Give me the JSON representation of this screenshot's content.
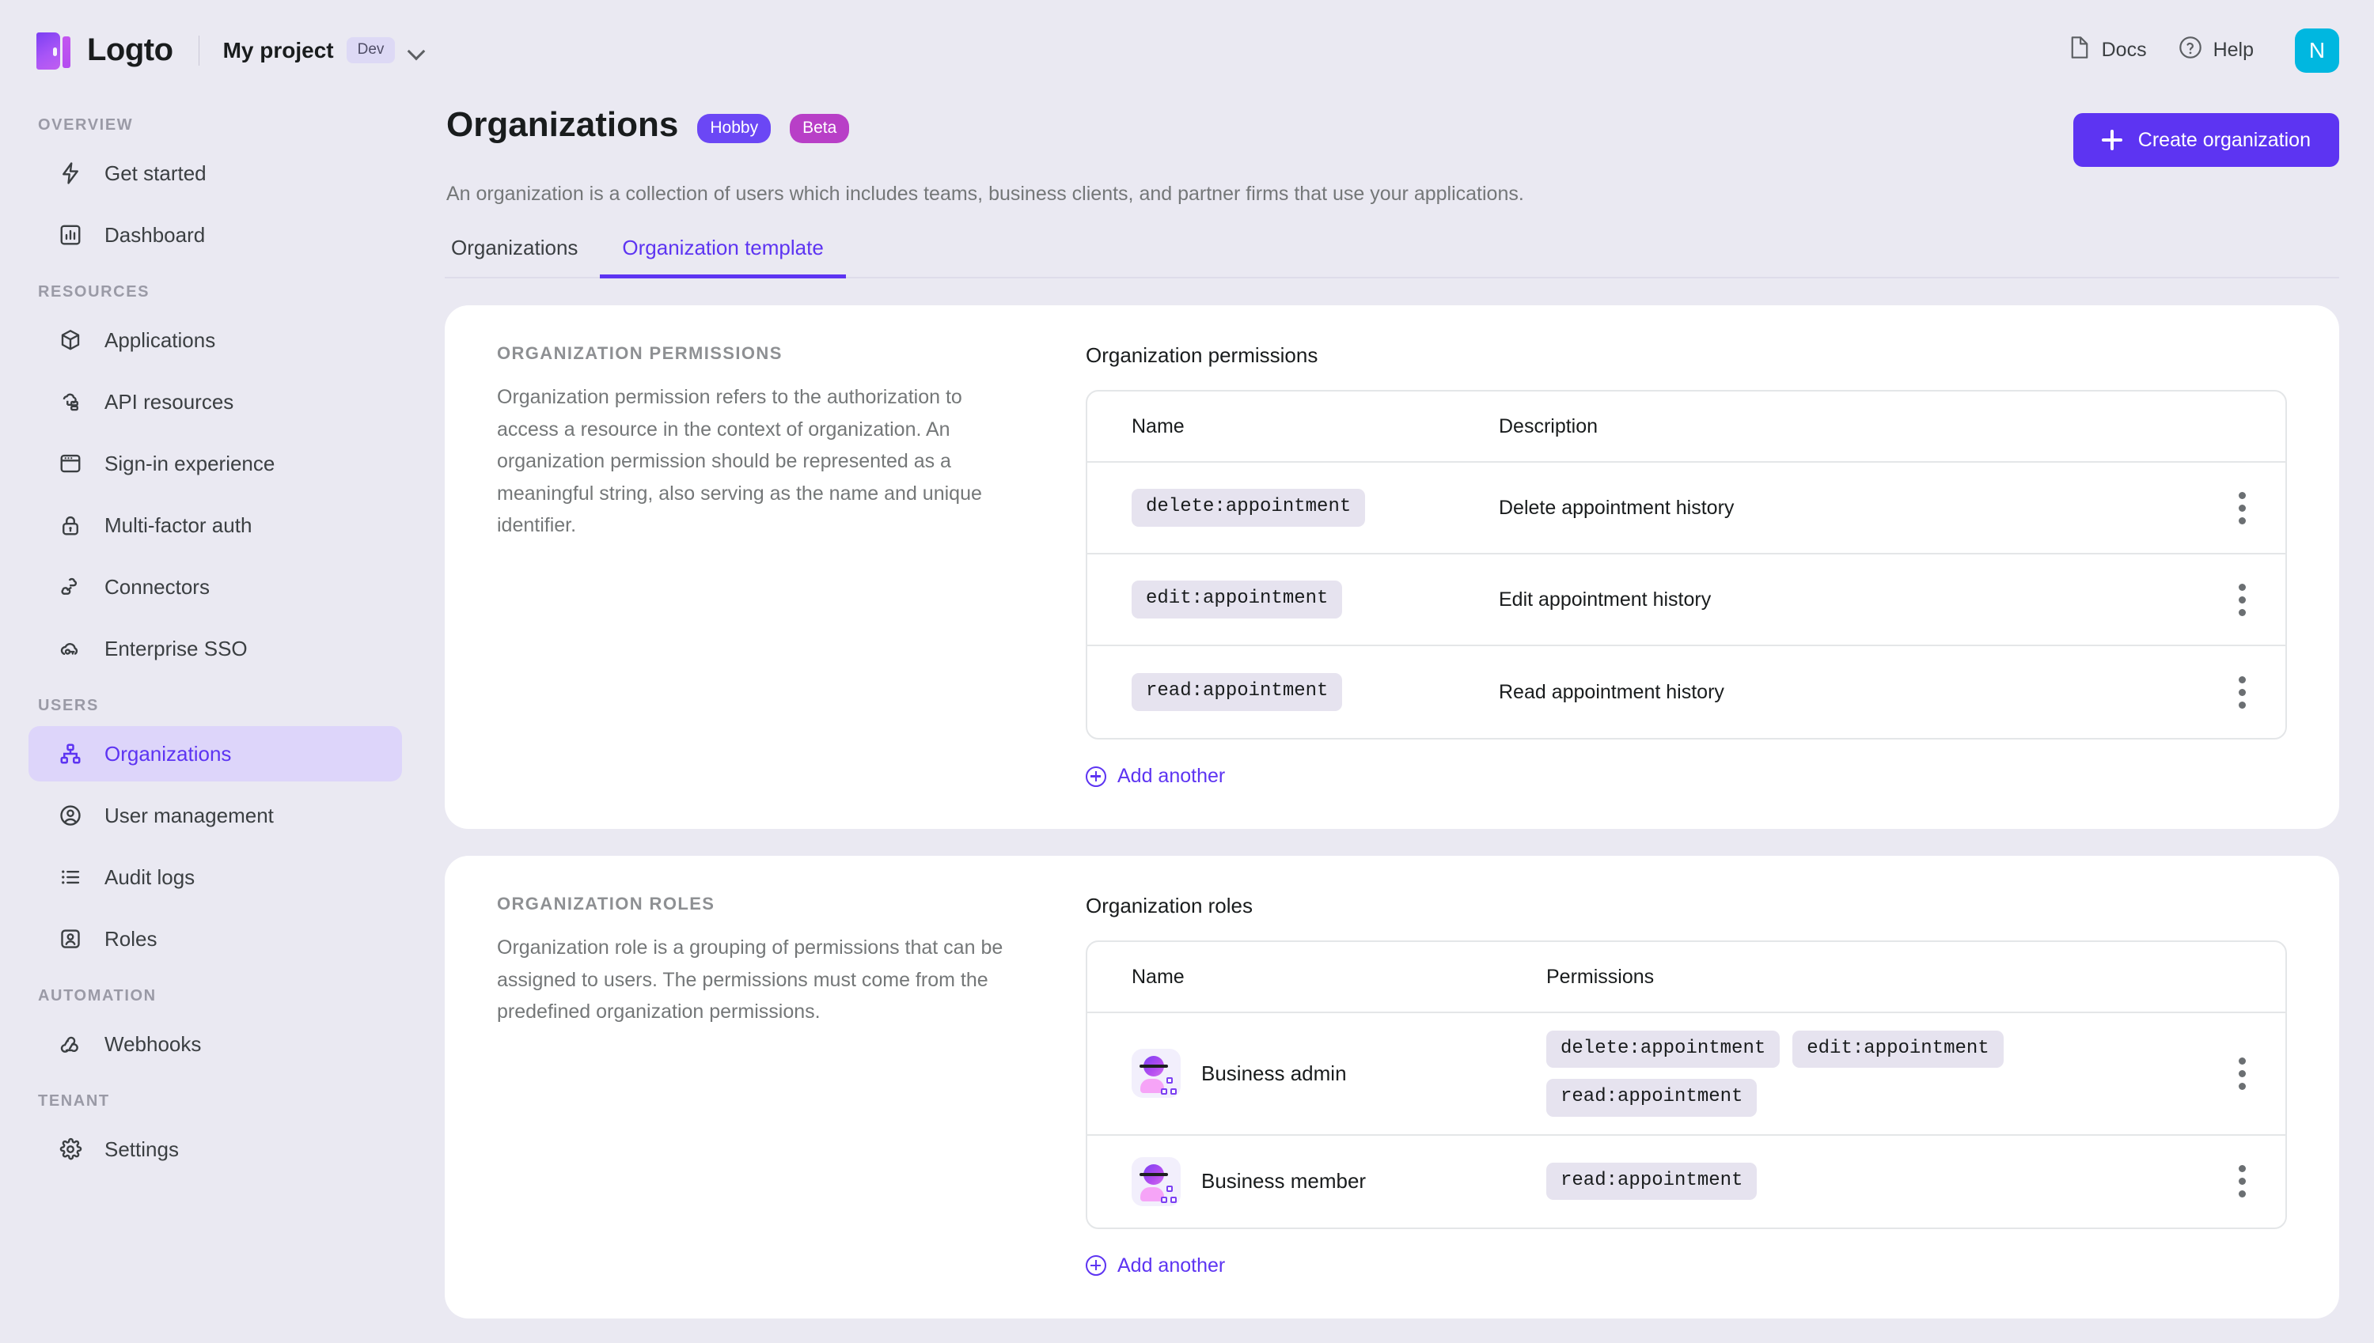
{
  "topbar": {
    "logo_text": "Logto",
    "project_name": "My project",
    "env_chip": "Dev",
    "docs_label": "Docs",
    "help_label": "Help",
    "avatar_initial": "N"
  },
  "sidebar": {
    "sections": [
      {
        "label": "OVERVIEW",
        "items": [
          {
            "label": "Get started",
            "icon": "bolt-icon",
            "active": false
          },
          {
            "label": "Dashboard",
            "icon": "chart-icon",
            "active": false
          }
        ]
      },
      {
        "label": "RESOURCES",
        "items": [
          {
            "label": "Applications",
            "icon": "cube-icon",
            "active": false
          },
          {
            "label": "API resources",
            "icon": "api-icon",
            "active": false
          },
          {
            "label": "Sign-in experience",
            "icon": "window-icon",
            "active": false
          },
          {
            "label": "Multi-factor auth",
            "icon": "lock-icon",
            "active": false
          },
          {
            "label": "Connectors",
            "icon": "connector-icon",
            "active": false
          },
          {
            "label": "Enterprise SSO",
            "icon": "cloud-key-icon",
            "active": false
          }
        ]
      },
      {
        "label": "USERS",
        "items": [
          {
            "label": "Organizations",
            "icon": "org-chart-icon",
            "active": true
          },
          {
            "label": "User management",
            "icon": "user-circle-icon",
            "active": false
          },
          {
            "label": "Audit logs",
            "icon": "list-icon",
            "active": false
          },
          {
            "label": "Roles",
            "icon": "badge-person-icon",
            "active": false
          }
        ]
      },
      {
        "label": "AUTOMATION",
        "items": [
          {
            "label": "Webhooks",
            "icon": "webhook-icon",
            "active": false
          }
        ]
      },
      {
        "label": "TENANT",
        "items": [
          {
            "label": "Settings",
            "icon": "gear-icon",
            "active": false
          }
        ]
      }
    ]
  },
  "page": {
    "title": "Organizations",
    "badges": [
      {
        "label": "Hobby",
        "color": "#6b47f5"
      },
      {
        "label": "Beta",
        "color": "#b83fc7"
      }
    ],
    "subtitle": "An organization is a collection of users which includes teams, business clients, and partner firms that use your applications.",
    "create_button": "Create organization",
    "tabs": [
      {
        "label": "Organizations",
        "active": false
      },
      {
        "label": "Organization template",
        "active": true
      }
    ]
  },
  "permissions_section": {
    "side_title": "ORGANIZATION PERMISSIONS",
    "side_desc": "Organization permission refers to the authorization to access a resource in the context of organization. An organization permission should be represented as a meaningful string, also serving as the name and unique identifier.",
    "table_title": "Organization permissions",
    "columns": [
      "Name",
      "Description"
    ],
    "rows": [
      {
        "name": "delete:appointment",
        "description": "Delete appointment history"
      },
      {
        "name": "edit:appointment",
        "description": "Edit appointment history"
      },
      {
        "name": "read:appointment",
        "description": "Read appointment history"
      }
    ],
    "add_label": "Add another"
  },
  "roles_section": {
    "side_title": "ORGANIZATION ROLES",
    "side_desc": "Organization role is a grouping of permissions that can be assigned to users. The permissions must come from the predefined organization permissions.",
    "table_title": "Organization roles",
    "columns": [
      "Name",
      "Permissions"
    ],
    "rows": [
      {
        "name": "Business admin",
        "permissions": [
          "delete:appointment",
          "edit:appointment",
          "read:appointment"
        ]
      },
      {
        "name": "Business member",
        "permissions": [
          "read:appointment"
        ]
      }
    ],
    "add_label": "Add another"
  },
  "colors": {
    "accent": "#5d34f2",
    "page_bg": "#eae9f2",
    "card_bg": "#ffffff",
    "pill_bg": "#e6e3ef",
    "avatar_bg": "#00b7e0"
  }
}
